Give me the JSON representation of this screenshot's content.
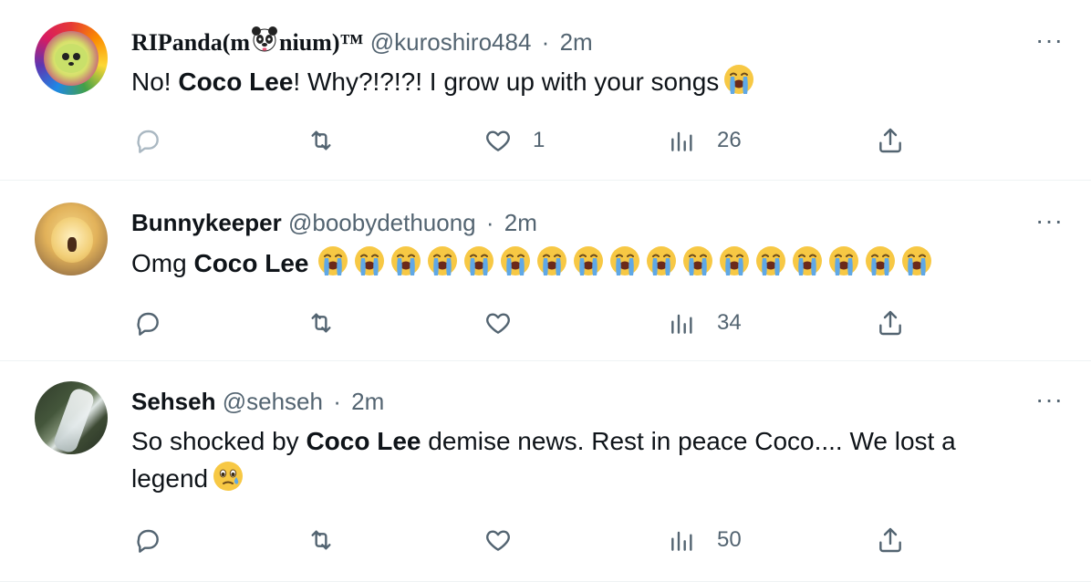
{
  "tweets": [
    {
      "name_pre": "RIPanda(m",
      "name_post": "nium)™",
      "handle": "@kuroshiro484",
      "sep": "·",
      "time": "2m",
      "text_pre": "No! ",
      "text_bold": "Coco Lee",
      "text_post": "! Why?!?!?! I grow up with your songs",
      "emoji_count": 1,
      "emoji": "loudly-crying-face",
      "reply_count": "",
      "retweet_count": "",
      "like_count": "1",
      "view_count": "26",
      "more": "···"
    },
    {
      "name": "Bunnykeeper",
      "handle": "@boobydethuong",
      "sep": "·",
      "time": "2m",
      "text_pre": "Omg ",
      "text_bold": "Coco Lee",
      "text_post": "",
      "emoji_count": 17,
      "emoji": "loudly-crying-face",
      "reply_count": "",
      "retweet_count": "",
      "like_count": "",
      "view_count": "34",
      "more": "···"
    },
    {
      "name": "Sehseh",
      "handle": "@sehseh",
      "sep": "·",
      "time": "2m",
      "text_pre": "So shocked by ",
      "text_bold": "Coco Lee",
      "text_post": " demise news. Rest in peace Coco.... We lost a legend",
      "emoji_count": 1,
      "emoji": "face-holding-back-tears",
      "reply_count": "",
      "retweet_count": "",
      "like_count": "",
      "view_count": "50",
      "more": "···"
    }
  ],
  "colors": {
    "text": "#0f1419",
    "secondary": "#536471",
    "divider": "#eff3f4",
    "emoji_yellow": "#f7c844",
    "tear_blue": "#5fa8e6"
  },
  "icons": [
    "reply-icon",
    "retweet-icon",
    "like-icon",
    "views-icon",
    "share-icon",
    "more-icon",
    "panda-emoji"
  ]
}
